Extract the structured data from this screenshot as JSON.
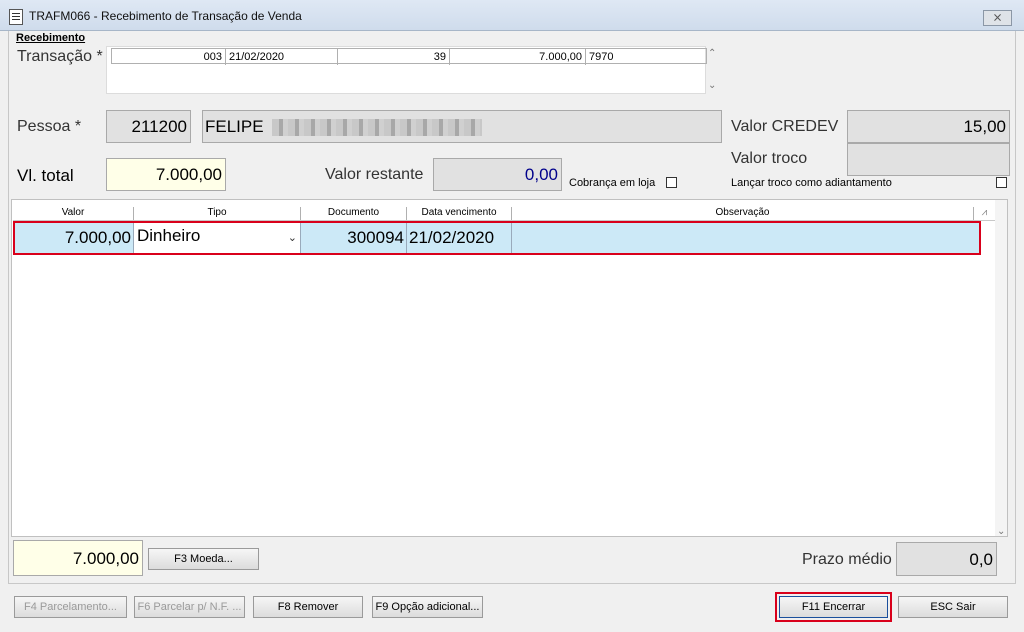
{
  "window": {
    "title": "TRAFM066 - Recebimento de Transação de Venda",
    "close_symbol": "⨯"
  },
  "section": {
    "title": "Recebimento"
  },
  "transacao": {
    "label": "Transação *",
    "col1": "003",
    "col2": "21/02/2020",
    "col3": "39",
    "col4": "7.000,00",
    "col5": "7970"
  },
  "pessoa": {
    "label": "Pessoa *",
    "code": "211200",
    "name": "FELIPE"
  },
  "credev": {
    "label": "Valor CREDEV",
    "value": "15,00"
  },
  "troco": {
    "label": "Valor troco",
    "value": "",
    "checkbox_label": "Lançar troco como adiantamento"
  },
  "vl_total": {
    "label": "Vl. total",
    "value": "7.000,00"
  },
  "restante": {
    "label": "Valor restante",
    "value": "0,00"
  },
  "cobranca": {
    "label": "Cobrança em loja"
  },
  "grid": {
    "headers": [
      "Valor",
      "Tipo",
      "Documento",
      "Data vencimento",
      "Observação"
    ],
    "rows": [
      {
        "valor": "7.000,00",
        "tipo": "Dinheiro",
        "documento": "300094",
        "data": "21/02/2020",
        "obs": ""
      }
    ]
  },
  "footer": {
    "total": "7.000,00",
    "moeda_button": "F3 Moeda...",
    "prazo_label": "Prazo médio",
    "prazo_value": "0,0"
  },
  "buttons": {
    "parcelamento": "F4 Parcelamento...",
    "parcelar_nf": "F6 Parcelar p/ N.F. ...",
    "remover": "F8 Remover",
    "opcao": "F9 Opção adicional...",
    "encerrar": "F11 Encerrar",
    "sair": "ESC Sair"
  },
  "colors": {
    "selection": "#cce9f7",
    "highlight_border": "#d9001b",
    "restante_value": "#00008b"
  }
}
